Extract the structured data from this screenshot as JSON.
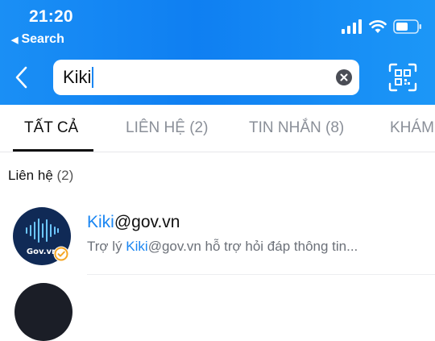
{
  "status_bar": {
    "time": "21:20",
    "back_app_label": "Search"
  },
  "search": {
    "query_prefix": "Kiki"
  },
  "tabs": [
    {
      "label": "TẤT CẢ",
      "active": true
    },
    {
      "label": "LIÊN HỆ (2)",
      "active": false
    },
    {
      "label": "TIN NHẮN (8)",
      "active": false
    },
    {
      "label": "KHÁM",
      "active": false
    }
  ],
  "section": {
    "title": "Liên hệ",
    "count": "(2)"
  },
  "contacts": [
    {
      "name_highlight": "Kiki",
      "name_rest": "@gov.vn",
      "desc_prefix": "Trợ lý ",
      "desc_highlight": "Kiki",
      "desc_rest": "@gov.vn hỗ trợ hỏi đáp thông tin...",
      "avatar_brand": "Gov.vn"
    }
  ],
  "colors": {
    "header_blue": "#1a8ff5",
    "highlight_blue": "#1a86f2",
    "avatar_navy": "#102a56",
    "verified_orange": "#f5a623"
  }
}
